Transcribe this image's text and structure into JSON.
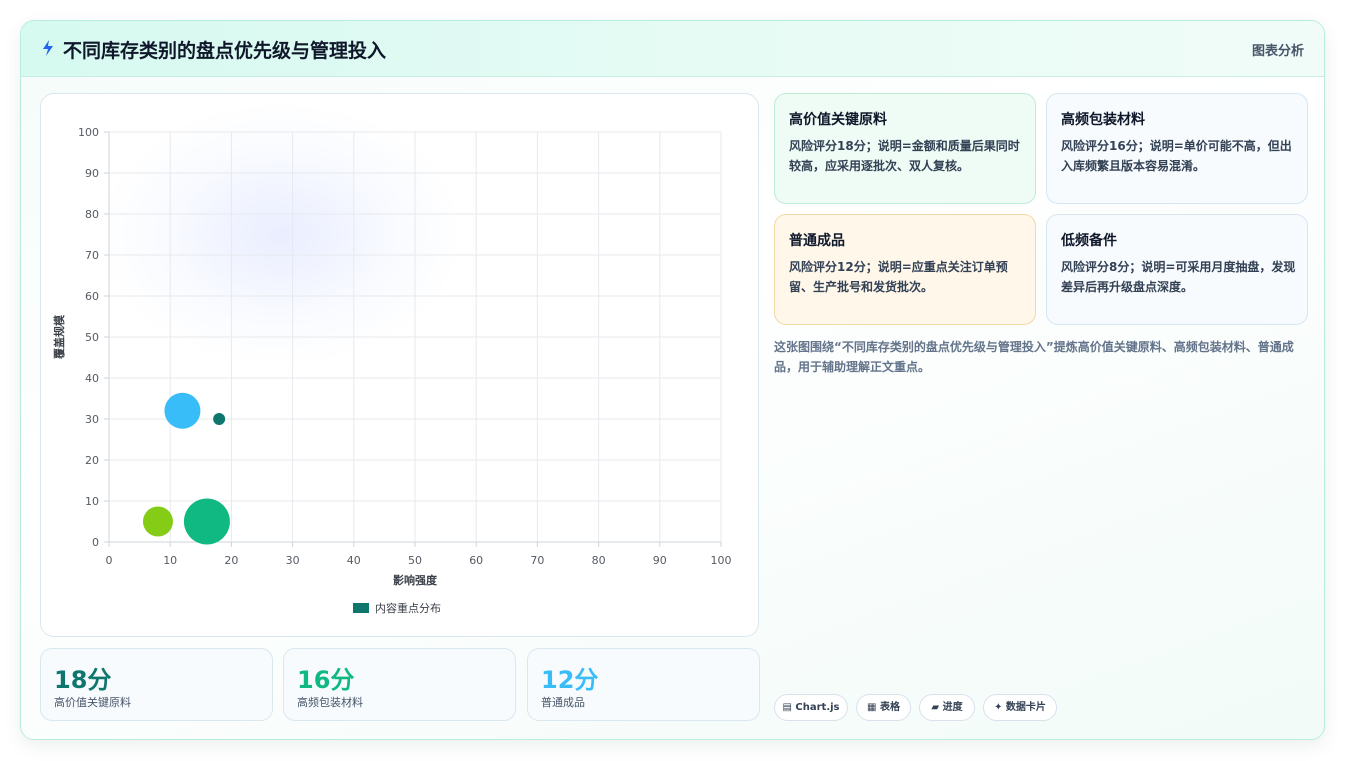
{
  "header": {
    "title": "不同库存类别的盘点优先级与管理投入",
    "tag": "图表分析",
    "logo_icon": "lightning-icon"
  },
  "chart_data": {
    "type": "bubble",
    "xlabel": "影响强度",
    "ylabel": "覆盖规模",
    "xlim": [
      0,
      100
    ],
    "ylim": [
      0,
      100
    ],
    "xticks": [
      0,
      10,
      20,
      30,
      40,
      50,
      60,
      70,
      80,
      90,
      100
    ],
    "yticks": [
      0,
      10,
      20,
      30,
      40,
      50,
      60,
      70,
      80,
      90,
      100
    ],
    "grid": true,
    "legend": {
      "label": "内容重点分布",
      "color": "#0f766e",
      "placement": "bottom"
    },
    "points": [
      {
        "x": 18,
        "y": 30,
        "r": 6,
        "color": "#0f766e"
      },
      {
        "x": 12,
        "y": 32,
        "r": 18,
        "color": "#38bdf8"
      },
      {
        "x": 8,
        "y": 5,
        "r": 15,
        "color": "#84cc16"
      },
      {
        "x": 16,
        "y": 5,
        "r": 23,
        "color": "#10b981"
      }
    ]
  },
  "stats": [
    {
      "value": "18分",
      "label": "高价值关键原料",
      "color": "#0f766e"
    },
    {
      "value": "16分",
      "label": "高频包装材料",
      "color": "#10b981"
    },
    {
      "value": "12分",
      "label": "普通成品",
      "color": "#38bdf8"
    }
  ],
  "cards": [
    {
      "title": "高价值关键原料",
      "desc": "风险评分18分；说明=金额和质量后果同时较高，应采用逐批次、双人复核。"
    },
    {
      "title": "高频包装材料",
      "desc": "风险评分16分；说明=单价可能不高，但出入库频繁且版本容易混淆。"
    },
    {
      "title": "普通成品",
      "desc": "风险评分12分；说明=应重点关注订单预留、生产批号和发货批次。"
    },
    {
      "title": "低频备件",
      "desc": "风险评分8分；说明=可采用月度抽盘，发现差异后再升级盘点深度。"
    }
  ],
  "summary": "这张图围绕“不同库存类别的盘点优先级与管理投入”提炼高价值关键原料、高频包装材料、普通成品，用于辅助理解正文重点。",
  "chips": [
    {
      "label": "▤ Chart.js"
    },
    {
      "label": "▦ 表格"
    },
    {
      "label": "▰ 进度"
    },
    {
      "label": "✦ 数据卡片"
    }
  ]
}
